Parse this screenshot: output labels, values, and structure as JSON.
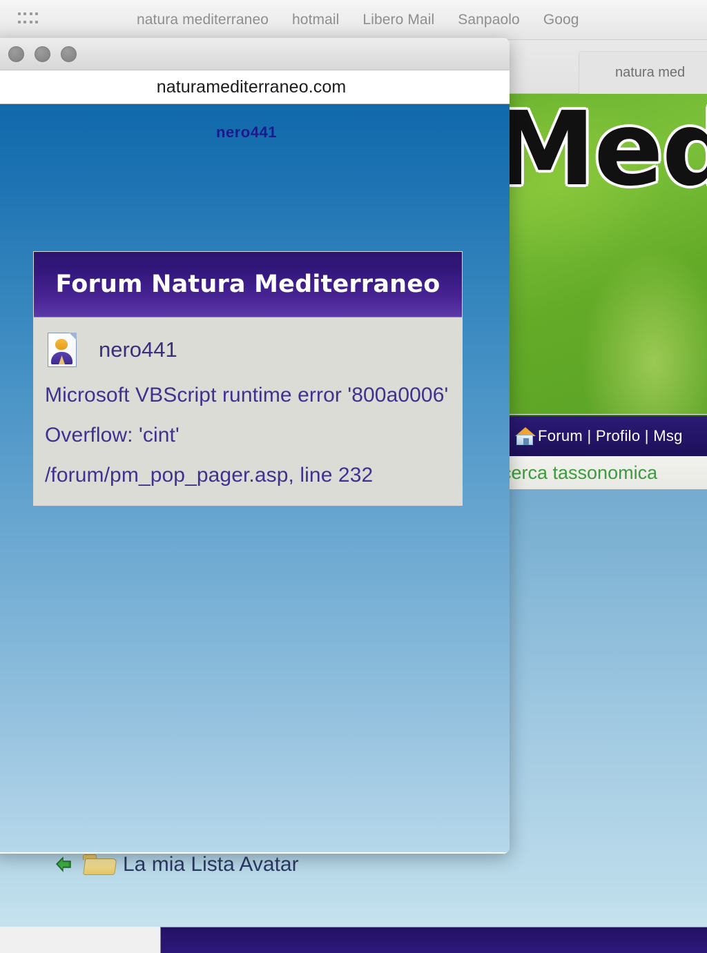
{
  "background_browser": {
    "bookmarks": [
      {
        "label": "natura mediterraneo"
      },
      {
        "label": "hotmail"
      },
      {
        "label": "Libero Mail"
      },
      {
        "label": "Sanpaolo"
      },
      {
        "label": "Goog"
      }
    ],
    "apps_grid_icon": "grid-dots-icon",
    "tab": {
      "label": "natura med"
    },
    "site": {
      "banner_text": "Medi",
      "nav_links": "Forum | Profilo | Msg",
      "home_icon": "house-icon",
      "sub_text": "cerca tassonomica",
      "avatar_list": {
        "arrow_icon": "green-arrow-icon",
        "folder_icon": "folder-icon",
        "label": "La mia Lista Avatar"
      }
    }
  },
  "popup": {
    "window_controls": [
      "close-button",
      "minimize-button",
      "maximize-button"
    ],
    "url": "naturamediterraneo.com",
    "page": {
      "heading": "nero441",
      "card": {
        "title": "Forum Natura Mediterraneo",
        "user": {
          "icon": "contact-card-icon",
          "name": "nero441"
        },
        "error": {
          "line1": "Microsoft VBScript runtime error '800a0006'",
          "line2": "Overflow: 'cint'",
          "line3": "/forum/pm_pop_pager.asp, line 232"
        }
      }
    }
  },
  "colors": {
    "popup_header_purple": "#34187d",
    "error_text": "#3f3190",
    "banner_green": "#6db42f",
    "nav_navy": "#241466",
    "sub_green": "#3c9b3c",
    "heading_blue": "#1a1a8c"
  }
}
